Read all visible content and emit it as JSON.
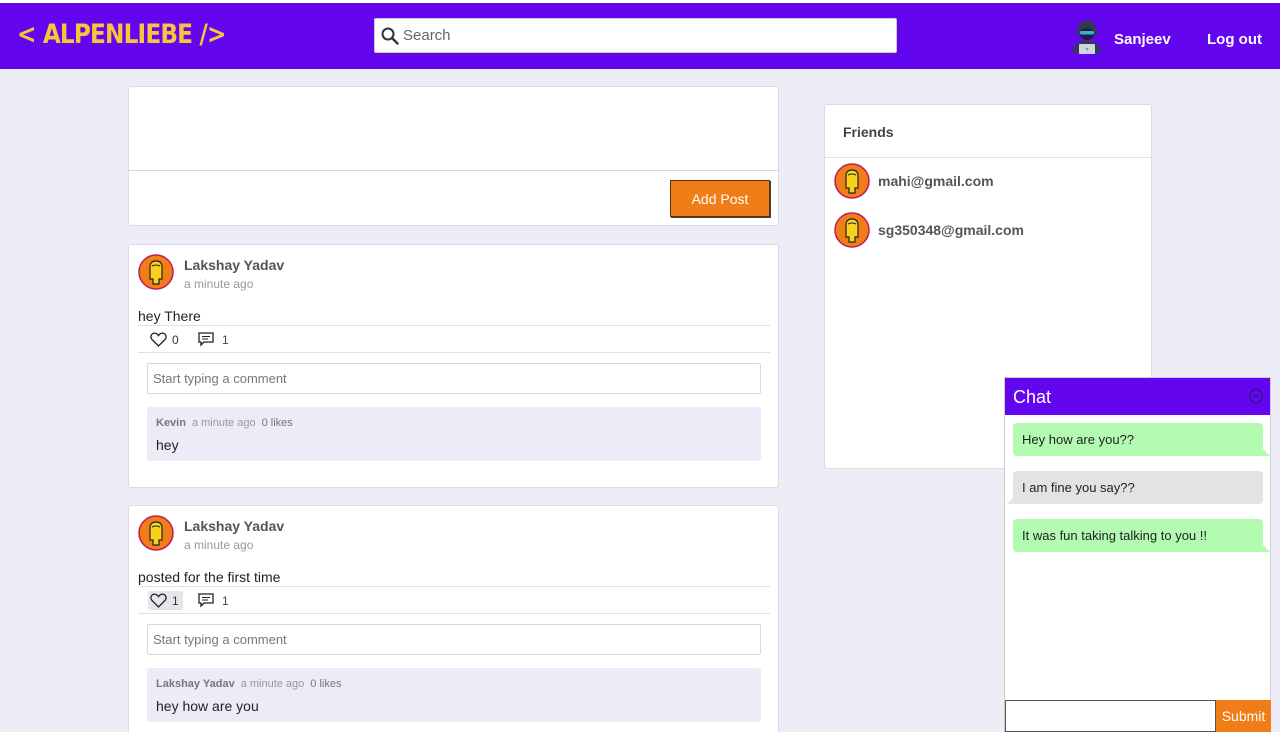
{
  "navbar": {
    "logo": "< ALPENLIEBE />",
    "search_placeholder": "Search",
    "username": "Sanjeev",
    "logout_label": "Log out",
    "background_color": "#6405f0",
    "logo_color": "#f7c53a"
  },
  "composer": {
    "add_post_label": "Add Post",
    "button_color": "#f07d18"
  },
  "posts": [
    {
      "author": "Lakshay Yadav",
      "time": "a minute ago",
      "text": "hey There",
      "likes": "0",
      "comments_count": "1",
      "liked": false,
      "comment_placeholder": "Start typing a comment",
      "comments": [
        {
          "author": "Kevin",
          "time": "a minute ago",
          "likes": "0 likes",
          "text": "hey"
        }
      ]
    },
    {
      "author": "Lakshay Yadav",
      "time": "a minute ago",
      "text": "posted for the first time",
      "likes": "1",
      "comments_count": "1",
      "liked": true,
      "comment_placeholder": "Start typing a comment",
      "comments": [
        {
          "author": "Lakshay Yadav",
          "time": "a minute ago",
          "likes": "0 likes",
          "text": "hey how are you"
        }
      ]
    }
  ],
  "friends": {
    "title": "Friends",
    "items": [
      {
        "name": "mahi@gmail.com"
      },
      {
        "name": "sg350348@gmail.com"
      }
    ]
  },
  "chat": {
    "title": "Chat",
    "messages": [
      {
        "text": "Hey how are you??",
        "side": "self",
        "color": "#b3fbb3"
      },
      {
        "text": "I am fine you say??",
        "side": "other",
        "color": "#e3e3e3"
      },
      {
        "text": "It was fun taking talking to you !!",
        "side": "self",
        "color": "#b3fbb3"
      }
    ],
    "input_value": "",
    "submit_label": "Submit"
  },
  "icons": {
    "search": "search-icon",
    "heart": "heart-icon",
    "comment": "comment-icon",
    "user_avatar": "hacker-avatar-icon",
    "friend_avatar": "user-avatar-icon",
    "minimize": "minimize-icon"
  }
}
